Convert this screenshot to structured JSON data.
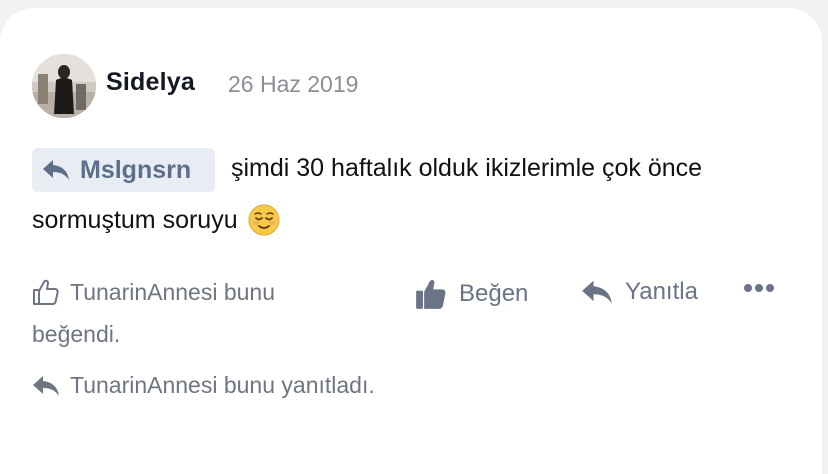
{
  "post": {
    "author": "Sidelya",
    "date": "26 Haz 2019",
    "mention": "Mslgnsrn",
    "message_line1": "şimdi 30 haftalık olduk ikizlerimle çok önce",
    "message_line2": "sormuştum soruyu",
    "emoji": "relieved-face"
  },
  "reactions": {
    "liked_line1": "TunarinAnnesi bunu",
    "liked_line2": "beğendi.",
    "replied": "TunarinAnnesi bunu yanıtladı."
  },
  "actions": {
    "like_label": "Beğen",
    "reply_label": "Yanıtla",
    "more_icon": "more-dots-icon"
  },
  "colors": {
    "accent": "#6b7386",
    "mention_bg": "#e8ecf3",
    "muted_text": "#8a8e98"
  }
}
